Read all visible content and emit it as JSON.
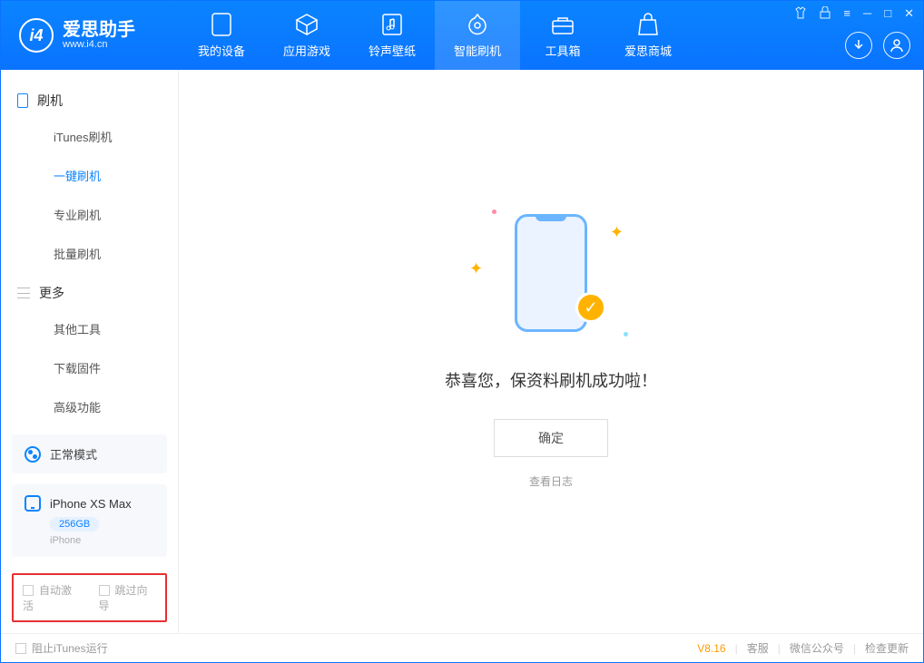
{
  "app": {
    "name": "爱思助手",
    "url": "www.i4.cn"
  },
  "tabs": [
    {
      "label": "我的设备"
    },
    {
      "label": "应用游戏"
    },
    {
      "label": "铃声壁纸"
    },
    {
      "label": "智能刷机"
    },
    {
      "label": "工具箱"
    },
    {
      "label": "爱思商城"
    }
  ],
  "sidebar": {
    "section1": {
      "title": "刷机",
      "items": [
        "iTunes刷机",
        "一键刷机",
        "专业刷机",
        "批量刷机"
      ]
    },
    "section2": {
      "title": "更多",
      "items": [
        "其他工具",
        "下载固件",
        "高级功能"
      ]
    },
    "mode": "正常模式",
    "device": {
      "name": "iPhone XS Max",
      "capacity": "256GB",
      "type": "iPhone"
    },
    "options": {
      "opt1": "自动激活",
      "opt2": "跳过向导"
    }
  },
  "main": {
    "success": "恭喜您，保资料刷机成功啦！",
    "ok": "确定",
    "viewlog": "查看日志"
  },
  "footer": {
    "block_itunes": "阻止iTunes运行",
    "version": "V8.16",
    "links": [
      "客服",
      "微信公众号",
      "检查更新"
    ]
  }
}
